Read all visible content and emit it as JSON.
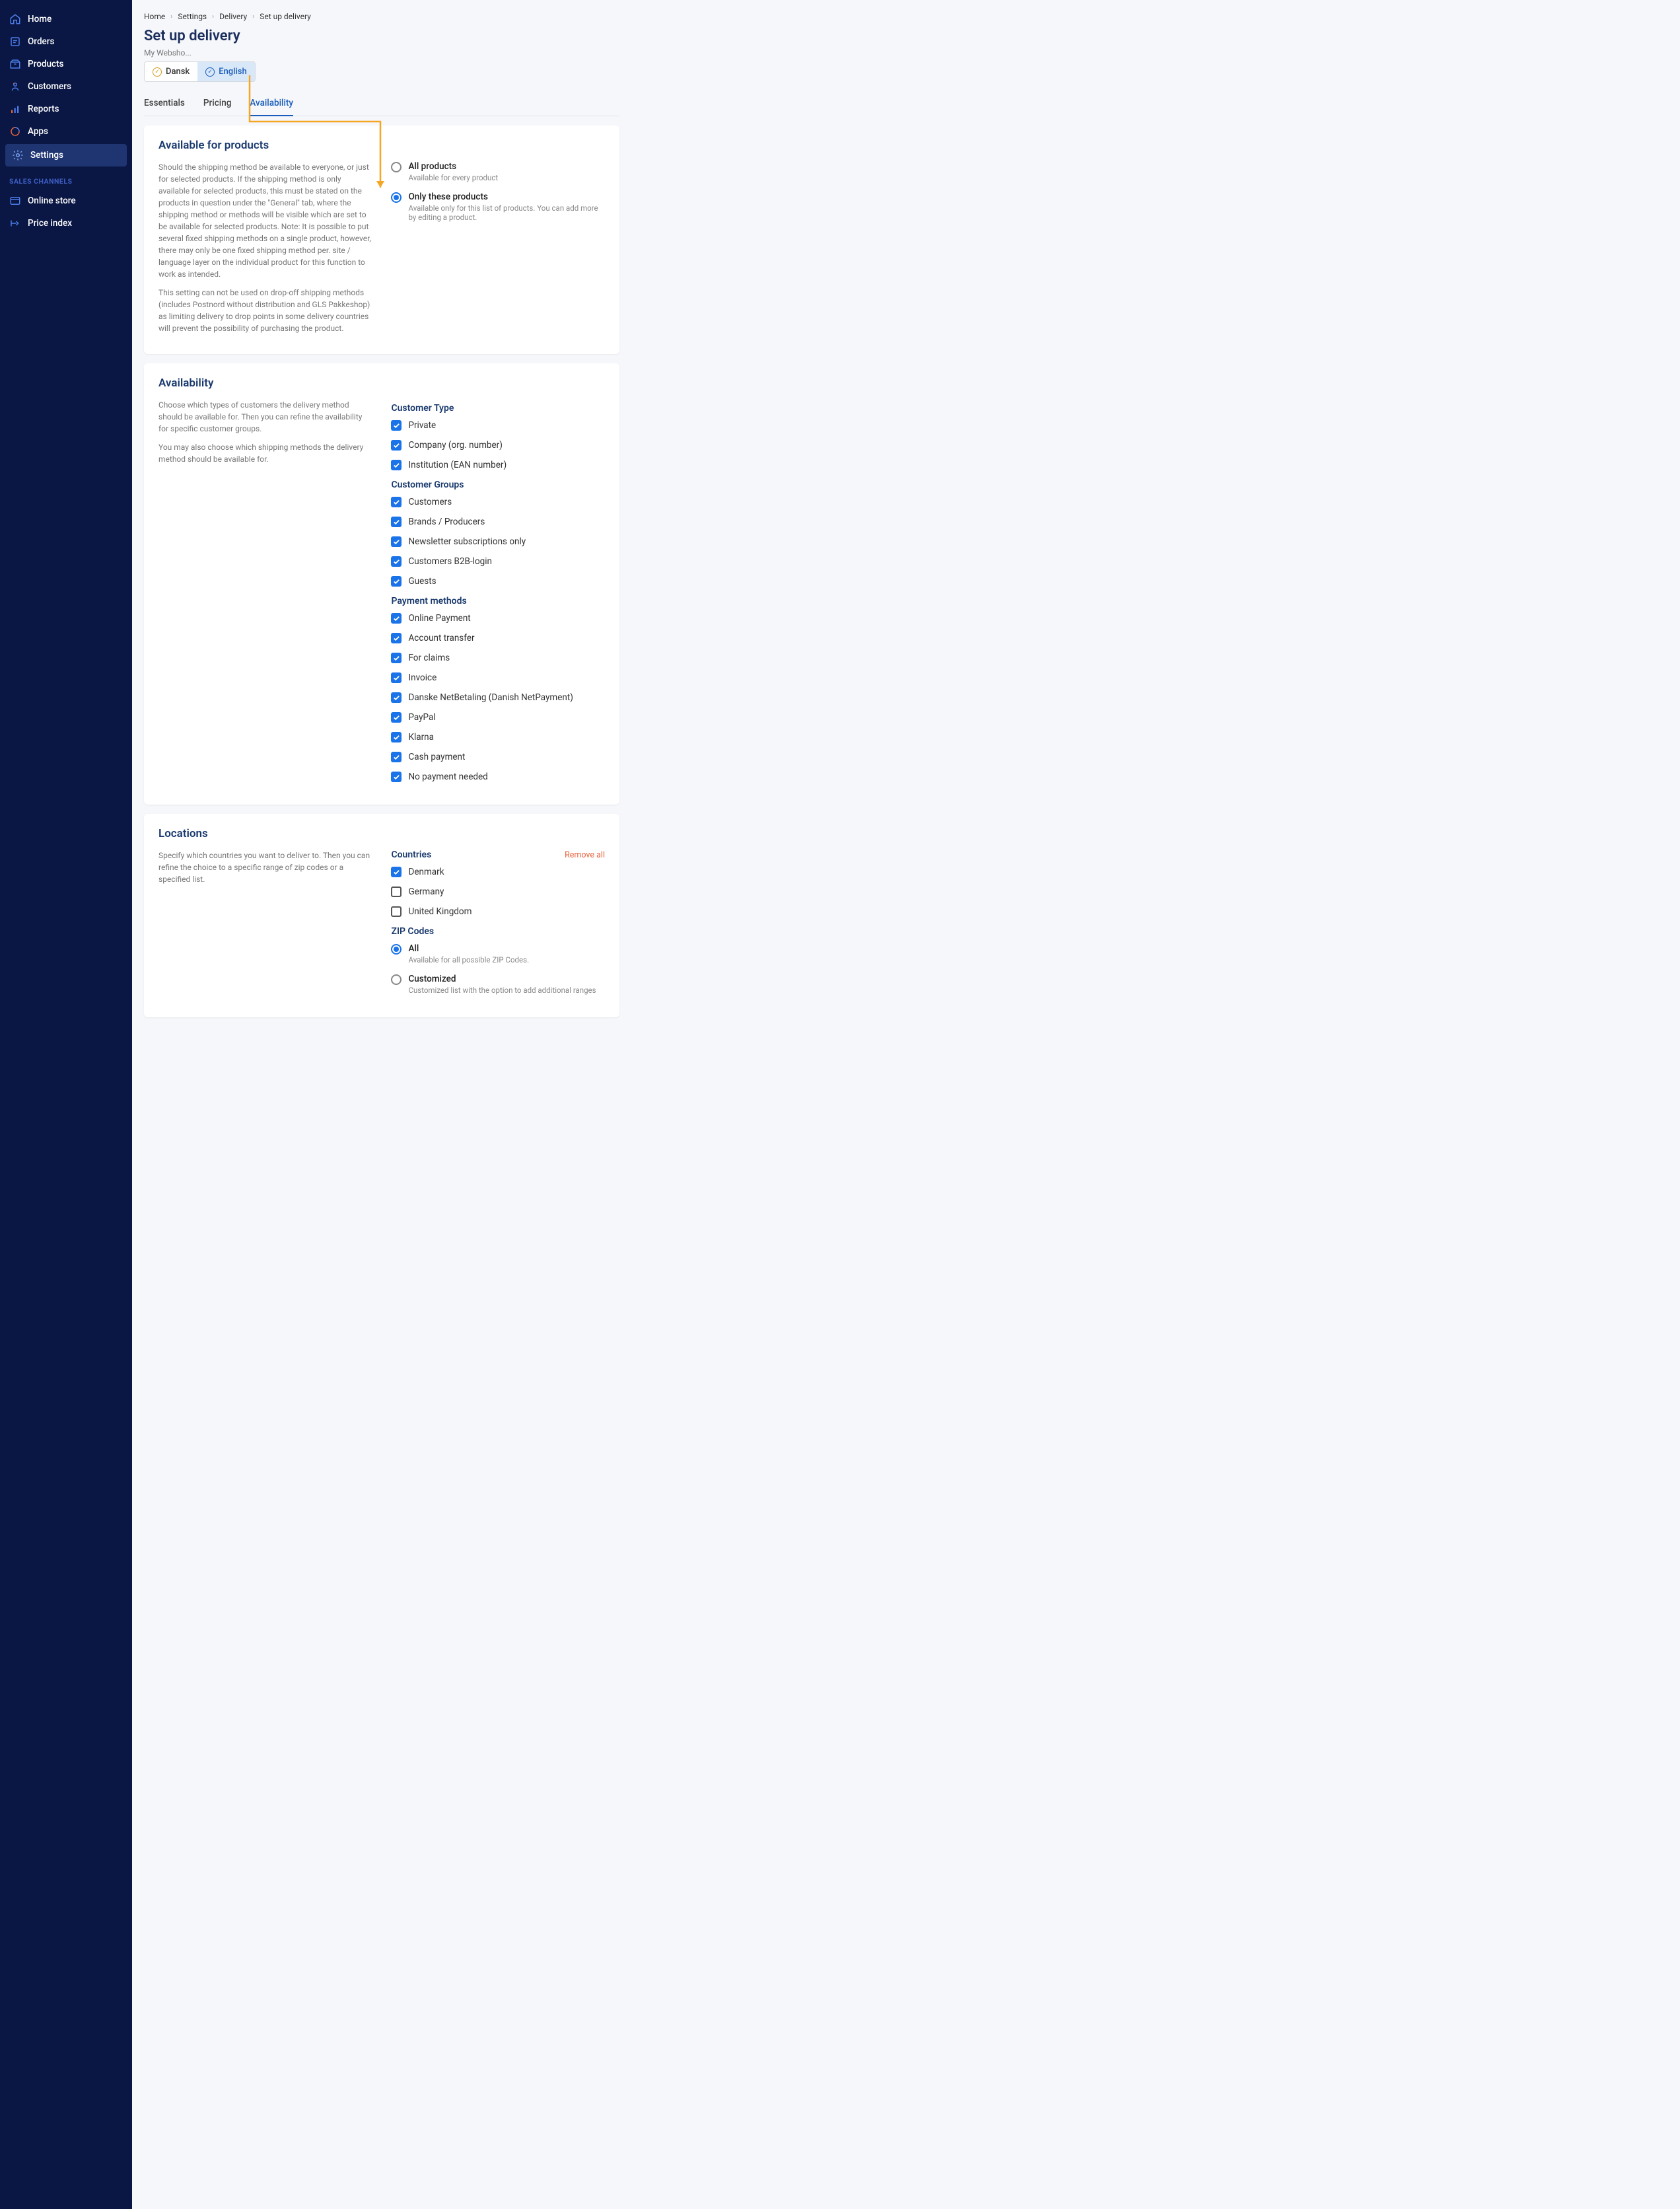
{
  "sidebar": {
    "items": [
      {
        "label": "Home"
      },
      {
        "label": "Orders"
      },
      {
        "label": "Products"
      },
      {
        "label": "Customers"
      },
      {
        "label": "Reports"
      },
      {
        "label": "Apps"
      },
      {
        "label": "Settings"
      }
    ],
    "section_label": "SALES CHANNELS",
    "channels": [
      {
        "label": "Online store"
      },
      {
        "label": "Price index"
      }
    ]
  },
  "breadcrumb": [
    "Home",
    "Settings",
    "Delivery",
    "Set up delivery"
  ],
  "page_title": "Set up delivery",
  "subtitle": "My Websho...",
  "languages": [
    {
      "label": "Dansk"
    },
    {
      "label": "English"
    }
  ],
  "tabs": [
    "Essentials",
    "Pricing",
    "Availability"
  ],
  "card_products": {
    "title": "Available for products",
    "help1": "Should the shipping method be available to everyone, or just for selected products. If the shipping method is only available for selected products, this must be stated on the products in question under the \"General\" tab, where the shipping method or methods will be visible which are set to be available for selected products. Note: It is possible to put several fixed shipping methods on a single product, however, there may only be one fixed shipping method per. site / language layer on the individual product for this function to work as intended.",
    "help2": "This setting can not be used on drop-off shipping methods (includes Postnord without distribution and GLS Pakkeshop) as limiting delivery to drop points in some delivery countries will prevent the possibility of purchasing the product.",
    "options": [
      {
        "label": "All products",
        "sub": "Available for every product"
      },
      {
        "label": "Only these products",
        "sub": "Available only for this list of products. You can add more by editing a product."
      }
    ]
  },
  "card_availability": {
    "title": "Availability",
    "help1": "Choose which types of customers the delivery method should be available for. Then you can refine the availability for specific customer groups.",
    "help2": "You may also choose which shipping methods the delivery method should be available for.",
    "customer_type_hd": "Customer Type",
    "customer_types": [
      "Private",
      "Company (org. number)",
      "Institution (EAN number)"
    ],
    "customer_groups_hd": "Customer Groups",
    "customer_groups": [
      "Customers",
      "Brands / Producers",
      "Newsletter subscriptions only",
      "Customers B2B-login",
      "Guests"
    ],
    "payment_hd": "Payment methods",
    "payment_methods": [
      "Online Payment",
      "Account transfer",
      "For claims",
      "Invoice",
      "Danske NetBetaling (Danish NetPayment)",
      "PayPal",
      "Klarna",
      "Cash payment",
      "No payment needed"
    ]
  },
  "card_locations": {
    "title": "Locations",
    "help": "Specify which countries you want to deliver to. Then you can refine the choice to a specific range of zip codes or a specified list.",
    "countries_hd": "Countries",
    "remove_all": "Remove all",
    "countries": [
      {
        "label": "Denmark",
        "checked": true
      },
      {
        "label": "Germany",
        "checked": false
      },
      {
        "label": "United Kingdom",
        "checked": false
      }
    ],
    "zip_hd": "ZIP Codes",
    "zip_options": [
      {
        "label": "All",
        "sub": "Available for all possible ZIP Codes."
      },
      {
        "label": "Customized",
        "sub": "Customized list with the option to add additional ranges"
      }
    ]
  }
}
